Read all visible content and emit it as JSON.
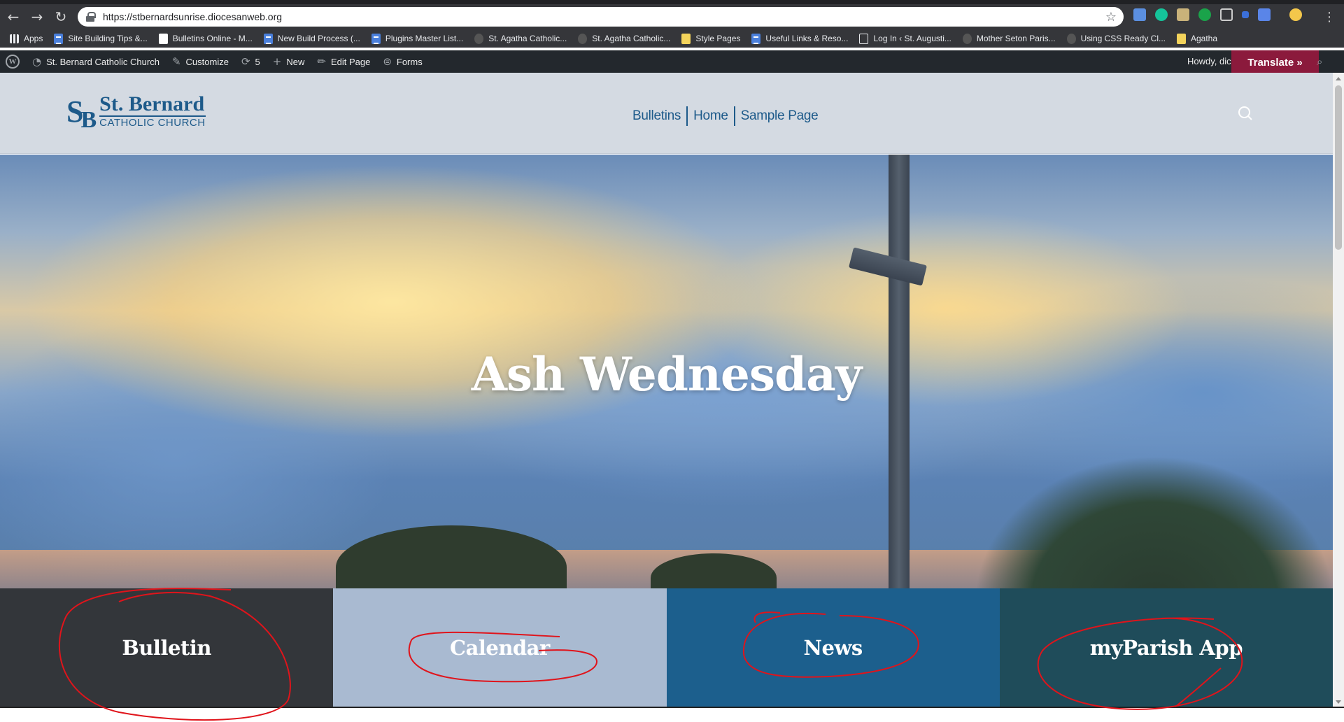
{
  "browser": {
    "url": "https://stbernardsunrise.diocesanweb.org",
    "bookmarks": [
      {
        "label": "Apps",
        "icon": "apps"
      },
      {
        "label": "Site Building Tips &...",
        "icon": "doc"
      },
      {
        "label": "Bulletins Online - M...",
        "icon": "white"
      },
      {
        "label": "New Build Process (...",
        "icon": "doc"
      },
      {
        "label": "Plugins Master List...",
        "icon": "doc"
      },
      {
        "label": "St. Agatha Catholic...",
        "icon": "dim"
      },
      {
        "label": "St. Agatha Catholic...",
        "icon": "dim"
      },
      {
        "label": "Style Pages",
        "icon": "folder"
      },
      {
        "label": "Useful Links & Reso...",
        "icon": "doc"
      },
      {
        "label": "Log In ‹ St. Augusti...",
        "icon": "outline"
      },
      {
        "label": "Mother Seton Paris...",
        "icon": "dim"
      },
      {
        "label": "Using CSS Ready Cl...",
        "icon": "dim"
      },
      {
        "label": "Agatha",
        "icon": "folder"
      }
    ]
  },
  "adminbar": {
    "site_name": "St. Bernard Catholic Church",
    "customize": "Customize",
    "updates": "5",
    "new": "New",
    "edit_page": "Edit Page",
    "forms": "Forms",
    "howdy": "Howdy, dic",
    "translate": "Translate »"
  },
  "site": {
    "logo_name": "St. Bernard",
    "logo_sub": "CATHOLIC CHURCH",
    "nav": [
      "Bulletins",
      "Home",
      "Sample Page"
    ]
  },
  "hero": {
    "title": "Ash Wednesday"
  },
  "tiles": [
    {
      "label": "Bulletin",
      "color": "#33363a"
    },
    {
      "label": "Calendar",
      "color": "#a9bad1"
    },
    {
      "label": "News",
      "color": "#1c5f8d"
    },
    {
      "label": "myParish App",
      "color": "#1f4c5a"
    }
  ],
  "annotation_color": "#e0141b"
}
